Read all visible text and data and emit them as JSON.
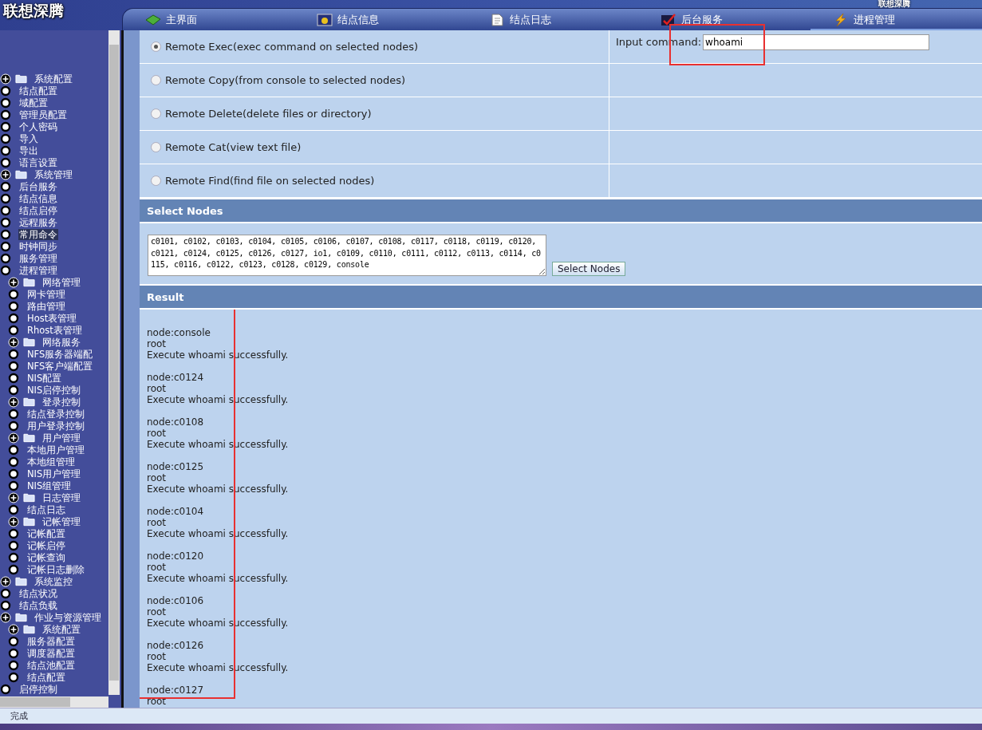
{
  "header": {
    "logo_text": "联想深腾",
    "right_logo_text": "联想深腾"
  },
  "tabs": [
    {
      "label": "主界面",
      "kind": "gem",
      "selected": false
    },
    {
      "label": "结点信息",
      "kind": "monitor",
      "selected": false
    },
    {
      "label": "结点日志",
      "kind": "doc",
      "selected": false
    },
    {
      "label": "后台服务",
      "kind": "check",
      "selected": false
    },
    {
      "label": "进程管理",
      "kind": "bolt",
      "selected": true
    }
  ],
  "sidebar": {
    "items": [
      {
        "label": "系统配置",
        "selected": false,
        "children": [
          {
            "label": "结点配置",
            "selected": false
          },
          {
            "label": "域配置",
            "selected": false
          },
          {
            "label": "管理员配置",
            "selected": false
          },
          {
            "label": "个人密码",
            "selected": false
          },
          {
            "label": "导入",
            "selected": false
          },
          {
            "label": "导出",
            "selected": false
          },
          {
            "label": "语言设置",
            "selected": false
          }
        ]
      },
      {
        "label": "系统管理",
        "selected": false,
        "children": [
          {
            "label": "后台服务",
            "selected": false
          },
          {
            "label": "结点信息",
            "selected": false
          },
          {
            "label": "结点启停",
            "selected": false
          },
          {
            "label": "远程服务",
            "selected": false
          },
          {
            "label": "常用命令",
            "selected": true
          },
          {
            "label": "时钟同步",
            "selected": false
          },
          {
            "label": "服务管理",
            "selected": false
          },
          {
            "label": "进程管理",
            "selected": false
          },
          {
            "label": "网络管理",
            "selected": false,
            "children": [
              {
                "label": "网卡管理",
                "selected": false
              },
              {
                "label": "路由管理",
                "selected": false
              },
              {
                "label": "Host表管理",
                "selected": false
              },
              {
                "label": "Rhost表管理",
                "selected": false
              }
            ]
          },
          {
            "label": "网络服务",
            "selected": false,
            "children": [
              {
                "label": "NFS服务器端配",
                "selected": false
              },
              {
                "label": "NFS客户端配置",
                "selected": false
              },
              {
                "label": "NIS配置",
                "selected": false
              },
              {
                "label": "NIS启停控制",
                "selected": false
              }
            ]
          },
          {
            "label": "登录控制",
            "selected": false,
            "children": [
              {
                "label": "结点登录控制",
                "selected": false
              },
              {
                "label": "用户登录控制",
                "selected": false
              }
            ]
          },
          {
            "label": "用户管理",
            "selected": false,
            "children": [
              {
                "label": "本地用户管理",
                "selected": false
              },
              {
                "label": "本地组管理",
                "selected": false
              },
              {
                "label": "NIS用户管理",
                "selected": false
              },
              {
                "label": "NIS组管理",
                "selected": false
              }
            ]
          },
          {
            "label": "日志管理",
            "selected": false,
            "children": [
              {
                "label": "结点日志",
                "selected": false
              }
            ]
          },
          {
            "label": "记帐管理",
            "selected": false,
            "children": [
              {
                "label": "记帐配置",
                "selected": false
              },
              {
                "label": "记帐启停",
                "selected": false
              },
              {
                "label": "记帐查询",
                "selected": false
              },
              {
                "label": "记帐日志删除",
                "selected": false
              }
            ]
          }
        ]
      },
      {
        "label": "系统监控",
        "selected": false,
        "children": [
          {
            "label": "结点状况",
            "selected": false
          },
          {
            "label": "结点负载",
            "selected": false
          }
        ]
      },
      {
        "label": "作业与资源管理",
        "selected": false,
        "children": [
          {
            "label": "系统配置",
            "selected": false,
            "children": [
              {
                "label": "服务器配置",
                "selected": false
              },
              {
                "label": "调度器配置",
                "selected": false
              },
              {
                "label": "结点池配置",
                "selected": false
              },
              {
                "label": "结点配置",
                "selected": false
              }
            ]
          },
          {
            "label": "启停控制",
            "selected": false
          }
        ]
      }
    ]
  },
  "operations": [
    {
      "label": "Remote Exec(exec command on selected nodes)",
      "selected": true
    },
    {
      "label": "Remote Copy(from console to selected nodes)",
      "selected": false
    },
    {
      "label": "Remote Delete(delete files or directory)",
      "selected": false
    },
    {
      "label": "Remote Cat(view text file)",
      "selected": false
    },
    {
      "label": "Remote Find(find file on selected nodes)",
      "selected": false
    }
  ],
  "command": {
    "label": "Input command:",
    "value": "whoami",
    "highlighted": true
  },
  "select_nodes": {
    "title": "Select Nodes",
    "nodes": "c0101, c0102, c0103, c0104, c0105, c0106, c0107, c0108, c0117, c0118, c0119, c0120, c0121, c0124, c0125, c0126, c0127, io1, c0109, c0110, c0111, c0112, c0113, c0114, c0115, c0116, c0122, c0123, c0128, c0129, console",
    "button": "Select Nodes"
  },
  "result": {
    "title": "Result",
    "highlighted": true,
    "entries": [
      {
        "node": "node:console",
        "output": "root",
        "message": "Execute whoami successfully."
      },
      {
        "node": "node:c0124",
        "output": "root",
        "message": "Execute whoami successfully."
      },
      {
        "node": "node:c0108",
        "output": "root",
        "message": "Execute whoami successfully."
      },
      {
        "node": "node:c0125",
        "output": "root",
        "message": "Execute whoami successfully."
      },
      {
        "node": "node:c0104",
        "output": "root",
        "message": "Execute whoami successfully."
      },
      {
        "node": "node:c0120",
        "output": "root",
        "message": "Execute whoami successfully."
      },
      {
        "node": "node:c0106",
        "output": "root",
        "message": "Execute whoami successfully."
      },
      {
        "node": "node:c0126",
        "output": "root",
        "message": "Execute whoami successfully."
      },
      {
        "node": "node:c0127",
        "output": "root"
      }
    ]
  },
  "status_bar": {
    "text": "完成"
  }
}
